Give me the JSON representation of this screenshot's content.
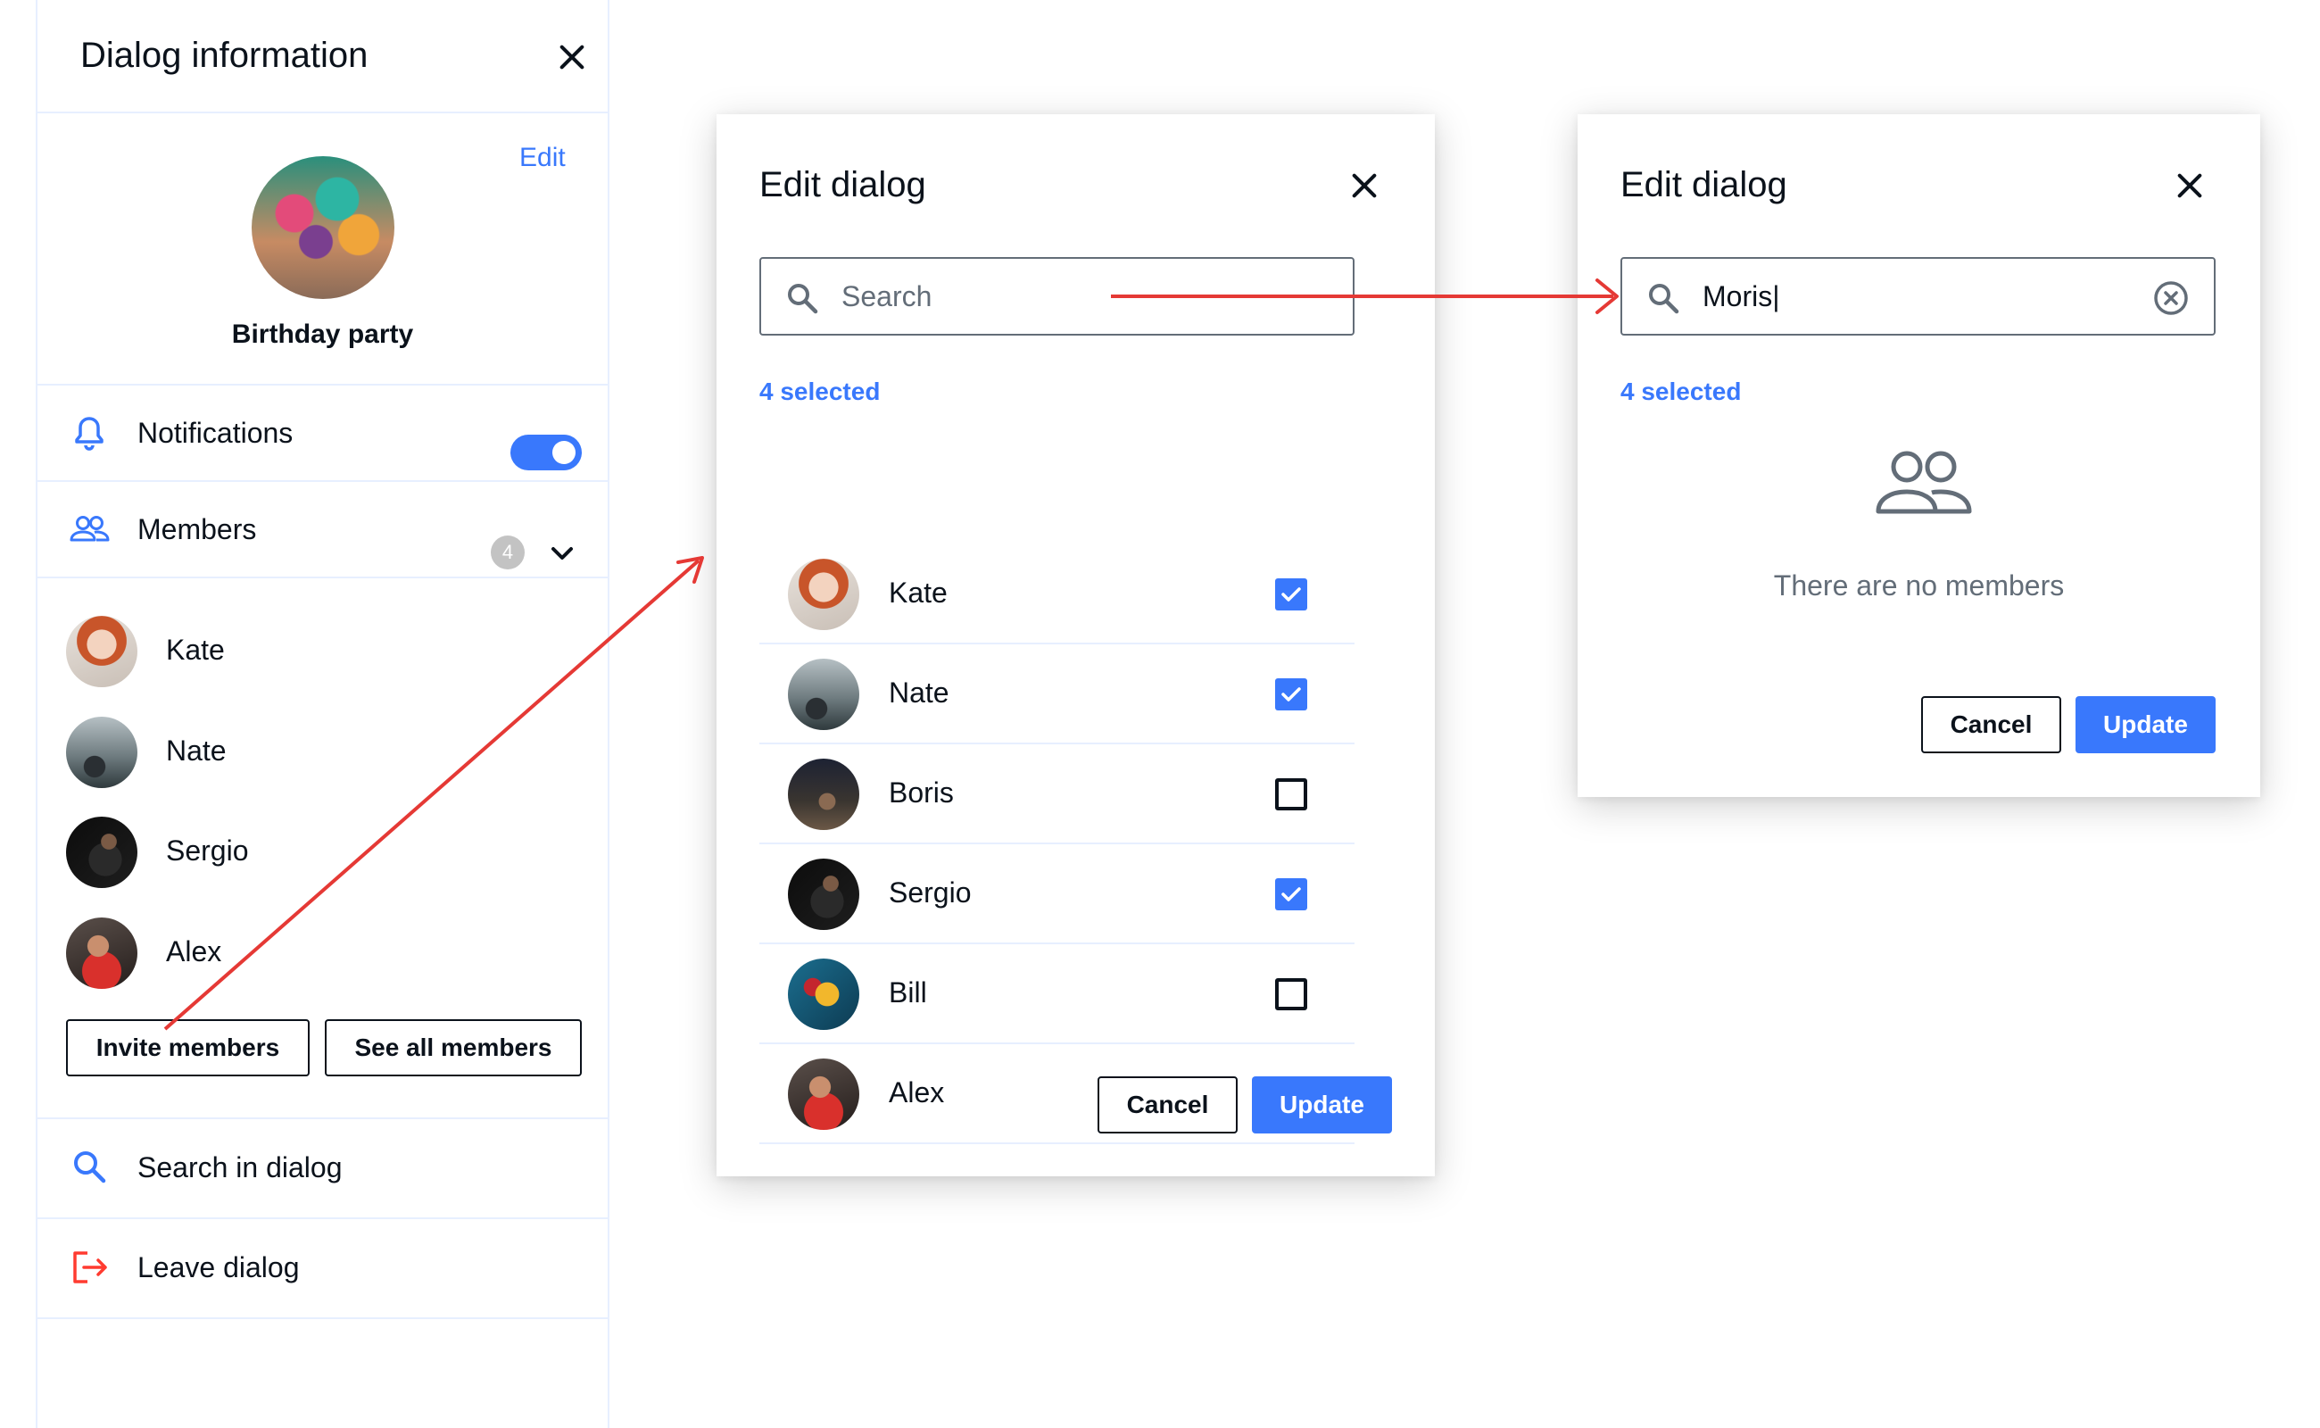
{
  "panel": {
    "title": "Dialog information",
    "edit_label": "Edit",
    "group_name": "Birthday party",
    "notifications_label": "Notifications",
    "notifications_on": true,
    "members_label": "Members",
    "members_count": "4",
    "members": [
      {
        "name": "Kate",
        "avatar": "woman-red-hair"
      },
      {
        "name": "Nate",
        "avatar": "man-mountain"
      },
      {
        "name": "Sergio",
        "avatar": "man-dark"
      },
      {
        "name": "Alex",
        "avatar": "man-red-shirt"
      }
    ],
    "invite_label": "Invite members",
    "see_all_label": "See all members",
    "search_label": "Search in dialog",
    "leave_label": "Leave dialog"
  },
  "edit_dialog": {
    "title": "Edit dialog",
    "search_placeholder": "Search",
    "selected_text": "4 selected",
    "members": [
      {
        "name": "Kate",
        "checked": true
      },
      {
        "name": "Nate",
        "checked": true
      },
      {
        "name": "Boris",
        "checked": false
      },
      {
        "name": "Sergio",
        "checked": true
      },
      {
        "name": "Bill",
        "checked": false
      },
      {
        "name": "Alex",
        "checked": true
      }
    ],
    "cancel_label": "Cancel",
    "update_label": "Update"
  },
  "search_dialog": {
    "title": "Edit dialog",
    "search_value": "Moris|",
    "selected_text": "4 selected",
    "empty_text": "There are no members",
    "cancel_label": "Cancel",
    "update_label": "Update"
  },
  "colors": {
    "accent": "#3978fc",
    "text": "#0b121b",
    "divider": "#e7efff",
    "danger": "#ff3b30",
    "muted": "#636d78",
    "arrow": "#e53935"
  },
  "icons": [
    "close-icon",
    "bell-icon",
    "members-icon",
    "chevron-down-icon",
    "search-icon",
    "leave-icon",
    "clear-icon",
    "checkbox-check-icon",
    "empty-members-icon"
  ]
}
